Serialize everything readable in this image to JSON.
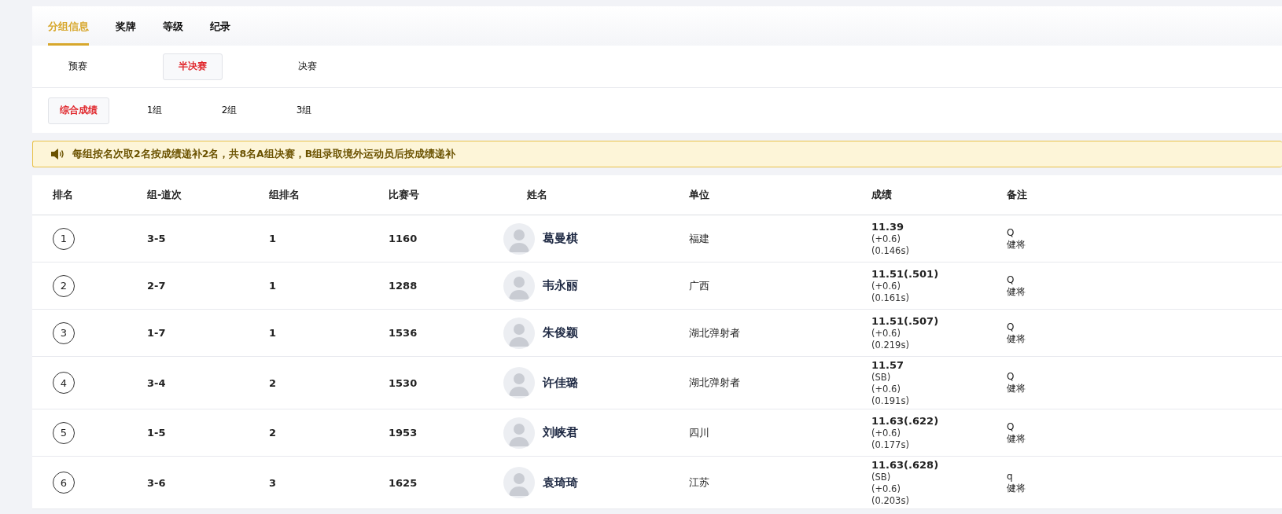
{
  "tabs": [
    {
      "label": "分组信息",
      "selected": true
    },
    {
      "label": "奖牌",
      "selected": false
    },
    {
      "label": "等级",
      "selected": false
    },
    {
      "label": "纪录",
      "selected": false
    }
  ],
  "rounds": [
    {
      "label": "预赛",
      "selected": false
    },
    {
      "label": "半决赛",
      "selected": true
    },
    {
      "label": "决赛",
      "selected": false
    }
  ],
  "groups": [
    {
      "label": "综合成绩",
      "selected": true
    },
    {
      "label": "1组",
      "selected": false
    },
    {
      "label": "2组",
      "selected": false
    },
    {
      "label": "3组",
      "selected": false
    }
  ],
  "notice": "每组按名次取2名按成绩递补2名，共8名A组决赛，B组录取境外运动员后按成绩递补",
  "table": {
    "columns": [
      "排名",
      "组-道次",
      "组排名",
      "比赛号",
      "姓名",
      "单位",
      "成绩",
      "备注"
    ],
    "rows": [
      {
        "rank": "1",
        "lane": "3-5",
        "group_rank": "1",
        "bib": "1160",
        "name": "葛曼棋",
        "unit": "福建",
        "result": "11.39",
        "result_notes": [
          "(+0.6)",
          "(0.146s)"
        ],
        "remarks": [
          "Q",
          "健将"
        ]
      },
      {
        "rank": "2",
        "lane": "2-7",
        "group_rank": "1",
        "bib": "1288",
        "name": "韦永丽",
        "unit": "广西",
        "result": "11.51(.501)",
        "result_notes": [
          "(+0.6)",
          "(0.161s)"
        ],
        "remarks": [
          "Q",
          "健将"
        ]
      },
      {
        "rank": "3",
        "lane": "1-7",
        "group_rank": "1",
        "bib": "1536",
        "name": "朱俊颖",
        "unit": "湖北弹射者",
        "result": "11.51(.507)",
        "result_notes": [
          "(+0.6)",
          "(0.219s)"
        ],
        "remarks": [
          "Q",
          "健将"
        ]
      },
      {
        "rank": "4",
        "lane": "3-4",
        "group_rank": "2",
        "bib": "1530",
        "name": "许佳璐",
        "unit": "湖北弹射者",
        "result": "11.57",
        "result_notes": [
          "(SB)",
          "(+0.6)",
          "(0.191s)"
        ],
        "remarks": [
          "Q",
          "健将"
        ]
      },
      {
        "rank": "5",
        "lane": "1-5",
        "group_rank": "2",
        "bib": "1953",
        "name": "刘峡君",
        "unit": "四川",
        "result": "11.63(.622)",
        "result_notes": [
          "(+0.6)",
          "(0.177s)"
        ],
        "remarks": [
          "Q",
          "健将"
        ]
      },
      {
        "rank": "6",
        "lane": "3-6",
        "group_rank": "3",
        "bib": "1625",
        "name": "袁琦琦",
        "unit": "江苏",
        "result": "11.63(.628)",
        "result_notes": [
          "(SB)",
          "(+0.6)",
          "(0.203s)"
        ],
        "remarks": [
          "q",
          "健将"
        ]
      }
    ]
  }
}
